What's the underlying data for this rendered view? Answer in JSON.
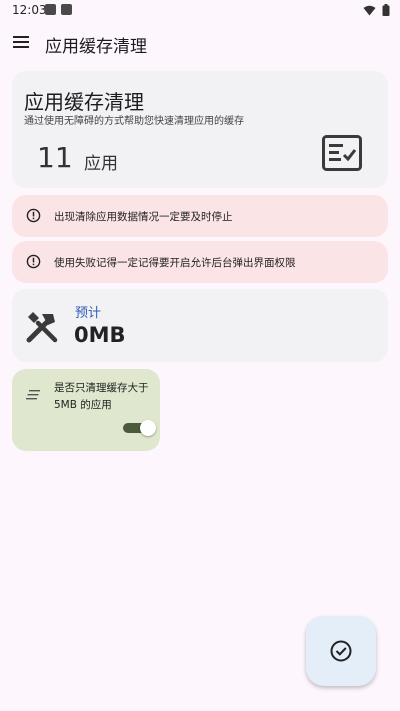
{
  "status_bar": {
    "time": "12:03",
    "icons": [
      "notification-icon",
      "notification-icon",
      "wifi-icon",
      "battery-icon"
    ]
  },
  "app_bar": {
    "menu_icon": "menu-icon",
    "title": "应用缓存清理"
  },
  "summary": {
    "title": "应用缓存清理",
    "subtitle": "通过使用无障碍的方式帮助您快速清理应用的缓存",
    "count": "11",
    "count_unit": "应用",
    "icon": "checklist-icon"
  },
  "warnings": [
    {
      "icon": "alert-icon",
      "text": "出现清除应用数据情况一定要及时停止"
    },
    {
      "icon": "alert-icon",
      "text": "使用失败记得一定记得要开启允许后台弹出界面权限"
    }
  ],
  "estimate": {
    "icon": "tools-icon",
    "label": "预计",
    "value": "0MB"
  },
  "filter": {
    "icon": "list-icon",
    "text": "是否只清理缓存大于5MB 的应用",
    "toggle_on": true
  },
  "fab": {
    "icon": "check-circle-icon"
  },
  "colors": {
    "background": "#fdf7fd",
    "card": "#f2f1f3",
    "warning": "#fbe4e6",
    "filter_card": "#dfe8cf",
    "accent_text": "#2f5db8",
    "fab": "#e4eef8"
  }
}
